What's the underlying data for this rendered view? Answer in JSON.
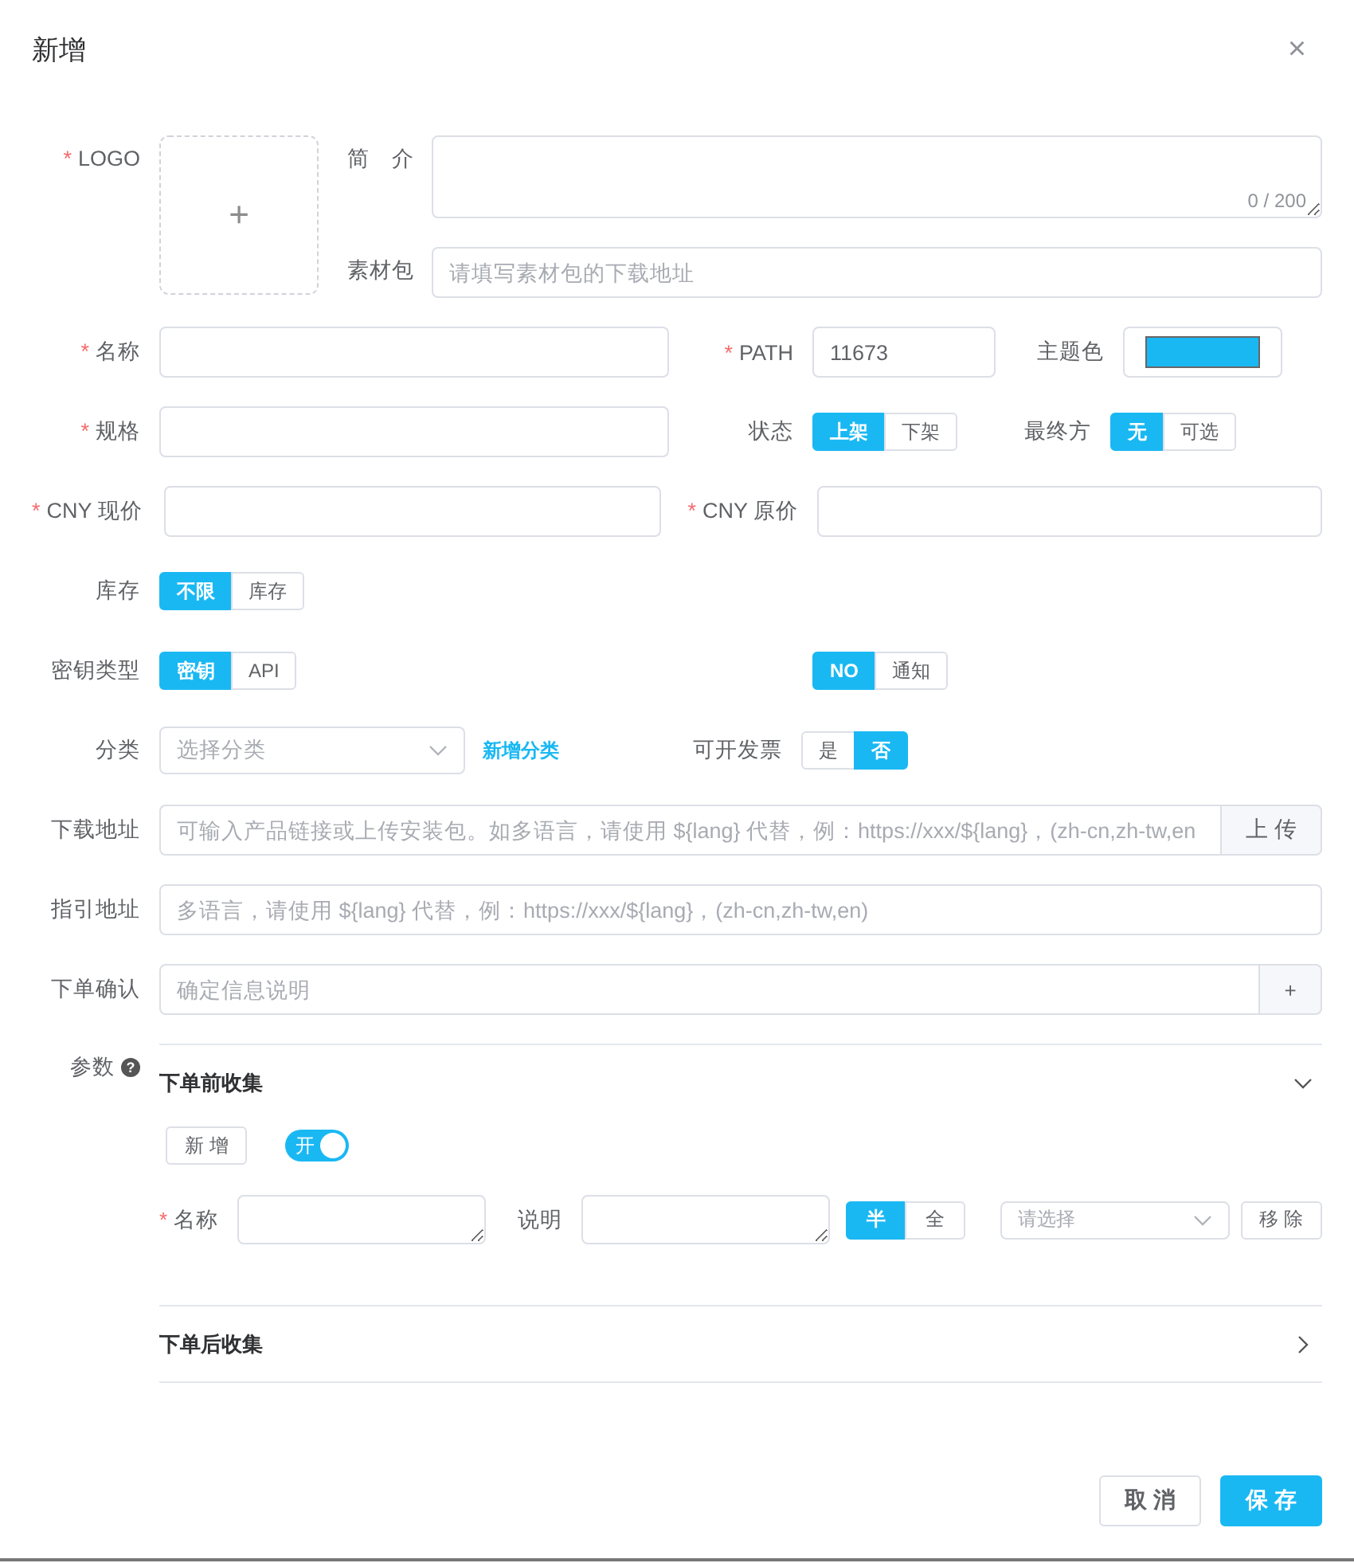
{
  "dialog": {
    "title": "新增",
    "close": "×"
  },
  "logo": {
    "label": "LOGO",
    "mark": "*",
    "plus": "+"
  },
  "intro": {
    "label": "简　介",
    "counter": "0 / 200"
  },
  "package": {
    "label": "素材包",
    "placeholder": "请填写素材包的下载地址"
  },
  "name": {
    "label": "名称",
    "mark": "*"
  },
  "path": {
    "label": "PATH",
    "mark": "*",
    "value": "11673"
  },
  "theme_color": {
    "label": "主题色",
    "color": "#1ab8f3"
  },
  "spec": {
    "label": "规格",
    "mark": "*"
  },
  "status": {
    "label": "状态",
    "options": [
      {
        "label": "上架",
        "selected": true
      },
      {
        "label": "下架",
        "selected": false
      }
    ]
  },
  "final_party": {
    "label": "最终方",
    "options": [
      {
        "label": "无",
        "selected": true
      },
      {
        "label": "可选",
        "selected": false
      }
    ]
  },
  "cny_current": {
    "label": "CNY 现价",
    "mark": "*"
  },
  "cny_original": {
    "label": "CNY 原价",
    "mark": "*"
  },
  "stock": {
    "label": "库存",
    "options": [
      {
        "label": "不限",
        "selected": true
      },
      {
        "label": "库存",
        "selected": false
      }
    ]
  },
  "key_type": {
    "label": "密钥类型",
    "options": [
      {
        "label": "密钥",
        "selected": true
      },
      {
        "label": "API",
        "selected": false
      }
    ]
  },
  "notify": {
    "options": [
      {
        "label": "NO",
        "selected": true
      },
      {
        "label": "通知",
        "selected": false
      }
    ]
  },
  "category": {
    "label": "分类",
    "placeholder": "选择分类",
    "link": "新增分类"
  },
  "invoice": {
    "label": "可开发票",
    "options": [
      {
        "label": "是",
        "selected": false
      },
      {
        "label": "否",
        "selected": true
      }
    ]
  },
  "download": {
    "label": "下载地址",
    "placeholder": "可输入产品链接或上传安装包。如多语言，请使用 ${lang} 代替，例：https://xxx/${lang}，(zh-cn,zh-tw,en",
    "button": "上 传"
  },
  "guide": {
    "label": "指引地址",
    "placeholder": "多语言，请使用 ${lang} 代替，例：https://xxx/${lang}，(zh-cn,zh-tw,en)"
  },
  "order_confirm": {
    "label": "下单确认",
    "placeholder": "确定信息说明",
    "button": "+"
  },
  "params": {
    "label": "参数",
    "help": "?",
    "panels": [
      {
        "title": "下单前收集",
        "expanded": true,
        "add_button": "新 增",
        "switch": {
          "label": "开",
          "on": true
        },
        "field": {
          "name_label": "名称",
          "mark": "*",
          "desc_label": "说明",
          "widths": [
            {
              "label": "半",
              "selected": true
            },
            {
              "label": "全",
              "selected": false
            }
          ],
          "select_placeholder": "请选择",
          "remove_button": "移 除"
        }
      },
      {
        "title": "下单后收集",
        "expanded": false
      }
    ]
  },
  "footer": {
    "cancel": "取 消",
    "save": "保 存"
  }
}
